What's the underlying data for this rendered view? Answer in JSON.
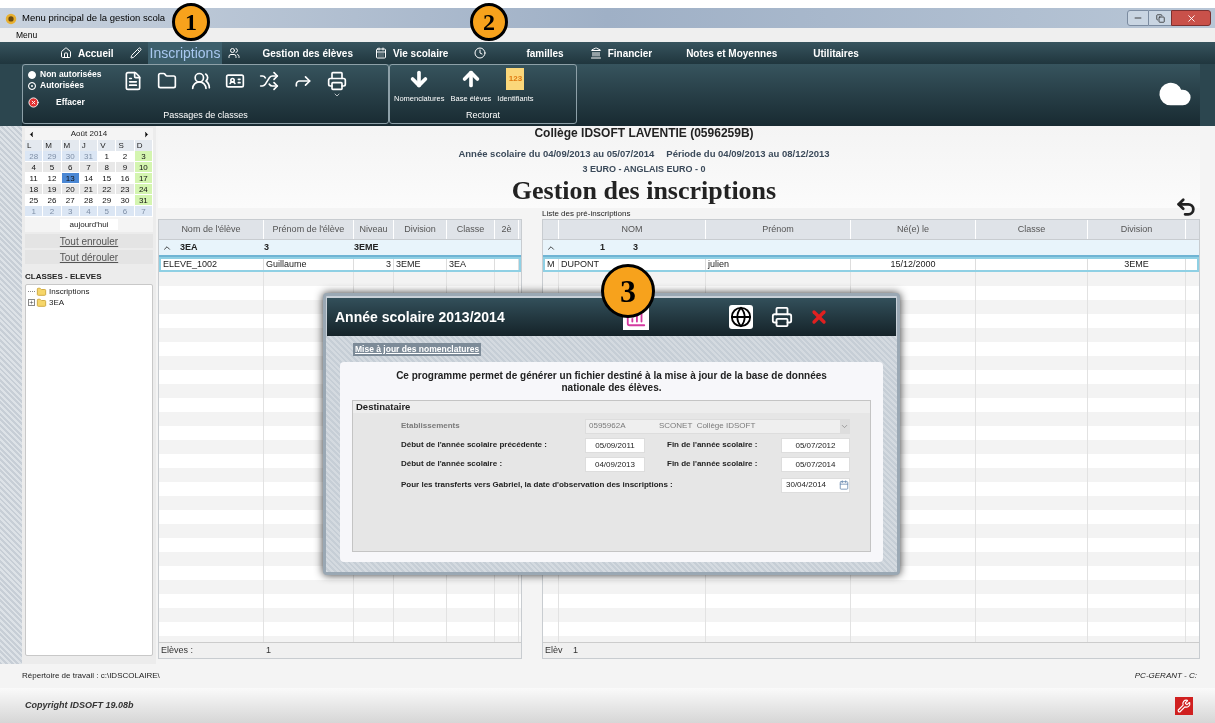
{
  "window": {
    "title": "Menu principal de la gestion scola"
  },
  "menu_bar": [
    "Menu"
  ],
  "nav": [
    {
      "label": "Accueil",
      "selected": false
    },
    {
      "label": "Inscriptions",
      "selected": true
    },
    {
      "label": "Gestion des élèves",
      "selected": false
    },
    {
      "label": "Vie scolaire",
      "selected": false
    },
    {
      "label": "familles",
      "selected": false
    },
    {
      "label": "Financier",
      "selected": false
    },
    {
      "label": "Notes et Moyennes",
      "selected": false
    },
    {
      "label": "Utilitaires",
      "selected": false
    }
  ],
  "ribbon": {
    "filters": [
      {
        "label": "Non autorisées",
        "selected": false
      },
      {
        "label": "Autorisées",
        "selected": true
      }
    ],
    "clear": "Effacer",
    "group_1": "Passages de classes",
    "group_2": {
      "label": "Rectorat",
      "buttons": [
        {
          "label": "Nomenclatures"
        },
        {
          "label": "Base élèves"
        },
        {
          "label": "Identifiants",
          "icon_text": "123"
        }
      ]
    }
  },
  "calendar": {
    "month": "Août 2014",
    "weekdays": [
      "L",
      "M",
      "M",
      "J",
      "V",
      "S",
      "D"
    ],
    "weeks": [
      [
        {
          "day": "28",
          "muted": true,
          "selected": false
        },
        {
          "day": "29",
          "muted": true,
          "selected": false
        },
        {
          "day": "30",
          "muted": true,
          "selected": false
        },
        {
          "day": "31",
          "muted": true,
          "selected": false
        },
        {
          "day": "1",
          "muted": false,
          "selected": false
        },
        {
          "day": "2",
          "muted": false,
          "selected": false
        },
        {
          "day": "3",
          "muted": false,
          "selected": false
        }
      ],
      [
        {
          "day": "4",
          "muted": false,
          "selected": false
        },
        {
          "day": "5",
          "muted": false,
          "selected": false
        },
        {
          "day": "6",
          "muted": false,
          "selected": false
        },
        {
          "day": "7",
          "muted": false,
          "selected": false
        },
        {
          "day": "8",
          "muted": false,
          "selected": false
        },
        {
          "day": "9",
          "muted": false,
          "selected": false
        },
        {
          "day": "10",
          "muted": false,
          "selected": false
        }
      ],
      [
        {
          "day": "11",
          "muted": false,
          "selected": false
        },
        {
          "day": "12",
          "muted": false,
          "selected": false
        },
        {
          "day": "13",
          "muted": false,
          "selected": true
        },
        {
          "day": "14",
          "muted": false,
          "selected": false
        },
        {
          "day": "15",
          "muted": false,
          "selected": false
        },
        {
          "day": "16",
          "muted": false,
          "selected": false
        },
        {
          "day": "17",
          "muted": false,
          "selected": false
        }
      ],
      [
        {
          "day": "18",
          "muted": false,
          "selected": false
        },
        {
          "day": "19",
          "muted": false,
          "selected": false
        },
        {
          "day": "20",
          "muted": false,
          "selected": false
        },
        {
          "day": "21",
          "muted": false,
          "selected": false
        },
        {
          "day": "22",
          "muted": false,
          "selected": false
        },
        {
          "day": "23",
          "muted": false,
          "selected": false
        },
        {
          "day": "24",
          "muted": false,
          "selected": false
        }
      ],
      [
        {
          "day": "25",
          "muted": false,
          "selected": false
        },
        {
          "day": "26",
          "muted": false,
          "selected": false
        },
        {
          "day": "27",
          "muted": false,
          "selected": false
        },
        {
          "day": "28",
          "muted": false,
          "selected": false
        },
        {
          "day": "29",
          "muted": false,
          "selected": false
        },
        {
          "day": "30",
          "muted": false,
          "selected": false
        },
        {
          "day": "31",
          "muted": false,
          "selected": false
        }
      ],
      [
        {
          "day": "1",
          "muted": true,
          "selected": false
        },
        {
          "day": "2",
          "muted": true,
          "selected": false
        },
        {
          "day": "3",
          "muted": true,
          "selected": false
        },
        {
          "day": "4",
          "muted": true,
          "selected": false
        },
        {
          "day": "5",
          "muted": true,
          "selected": false
        },
        {
          "day": "6",
          "muted": true,
          "selected": false
        },
        {
          "day": "7",
          "muted": true,
          "selected": false
        }
      ]
    ],
    "today": "aujourd'hui"
  },
  "sidebar": {
    "collapse_all": "Tout enrouler",
    "expand_all": "Tout dérouler",
    "tree_title": "CLASSES - ELEVES",
    "tree": [
      {
        "label": "Inscriptions",
        "expandable": false
      },
      {
        "label": "3EA",
        "expandable": true
      }
    ]
  },
  "header": {
    "school": "Collège IDSOFT LAVENTIE (0596259B)",
    "year": "Année scolaire du 04/09/2013 au 05/07/2014",
    "period": "Période du 04/09/2013 au 08/12/2013",
    "option": "3 EURO - ANGLAIS EURO - 0",
    "title": "Gestion des inscriptions"
  },
  "students_table": {
    "columns": [
      "Nom de l'élève",
      "Prénom de l'élève",
      "Niveau",
      "Division",
      "Classe",
      "2è"
    ],
    "group": [
      "3EA",
      "3",
      "3EME"
    ],
    "rows": [
      {
        "cells": [
          "ELEVE_1002",
          "Guillaume",
          "3",
          "3EME",
          "3EA",
          ""
        ],
        "selected": true
      }
    ],
    "footer": [
      "Elèves :",
      "1"
    ]
  },
  "preregistrations_table": {
    "label": "Liste des pré-inscriptions",
    "columns": [
      "",
      "NOM",
      "Prénom",
      "Né(e) le",
      "Classe",
      "Division"
    ],
    "group": [
      "1",
      "3"
    ],
    "rows": [
      {
        "cells": [
          "M",
          "DUPONT",
          "julien",
          "15/12/2000",
          "",
          "3EME"
        ],
        "selected": true
      }
    ],
    "footer": [
      "Elèv",
      "1"
    ]
  },
  "dialog": {
    "title": "Année scolaire 2013/2014",
    "link": "Mise à jour des nomenclatures",
    "intro": "Ce programme permet de générer un fichier destiné à la mise à jour de la base de données nationale des élèves.",
    "fieldset": "Destinataire",
    "establishment": {
      "label": "Etablissements",
      "code": "0595962A",
      "name": "SCONET  Collège IDSOFT",
      "disabled": true
    },
    "date_rows": [
      {
        "label": "Début de l'année scolaire précédente :",
        "value": "05/09/2011",
        "end_label": "Fin de l'année scolaire :",
        "end_value": "05/07/2012"
      },
      {
        "label": "Début de l'année scolaire :",
        "value": "04/09/2013",
        "end_label": "Fin de l'année scolaire :",
        "end_value": "05/07/2014"
      }
    ],
    "observation": {
      "label": "Pour les transferts vers Gabriel, la date d'observation des inscriptions :",
      "value": "30/04/2014"
    }
  },
  "status_bar": {
    "directory": "Répertoire de travail : c:\\IDSCOLAIRE\\",
    "machine": "PC-GERANT - C:"
  },
  "footer": {
    "copyright": "Copyright IDSOFT 19.08b"
  },
  "callouts": [
    "1",
    "2",
    "3"
  ]
}
